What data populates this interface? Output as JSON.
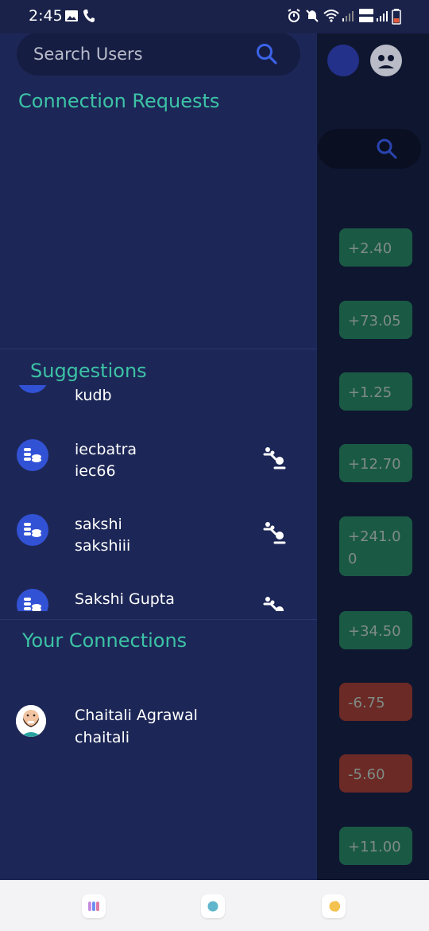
{
  "status_bar": {
    "time": "2:45"
  },
  "drawer": {
    "search": {
      "placeholder": "Search Users"
    },
    "connection_requests": {
      "title": "Connection Requests"
    },
    "suggestions": {
      "title": "Suggestions",
      "items": [
        {
          "name": "",
          "handle": "kudb"
        },
        {
          "name": "iecbatra",
          "handle": "iec66"
        },
        {
          "name": "sakshi",
          "handle": "sakshiii"
        },
        {
          "name": "Sakshi Gupta",
          "handle": ""
        }
      ]
    },
    "your_connections": {
      "title": "Your Connections",
      "items": [
        {
          "name": "Chaitali Agrawal",
          "handle": "chaitali"
        }
      ]
    }
  },
  "background": {
    "values": [
      {
        "line1": "+2.40",
        "line2": ""
      },
      {
        "line1": "+73.05",
        "line2": ""
      },
      {
        "line1": "+1.25",
        "line2": ""
      },
      {
        "line1": "+12.70",
        "line2": ""
      },
      {
        "line1": "+241.0",
        "line2": "0"
      },
      {
        "line1": "+34.50",
        "line2": ""
      },
      {
        "line1": "-6.75",
        "line2": ""
      },
      {
        "line1": "-5.60",
        "line2": ""
      },
      {
        "line1": "+11.00",
        "line2": ""
      }
    ]
  },
  "colors": {
    "accent": "#3cc3a6",
    "drawer_bg": "#1d2757",
    "positive": "#1a5a44",
    "negative": "#6b2a25",
    "avatar": "#3252d6"
  }
}
